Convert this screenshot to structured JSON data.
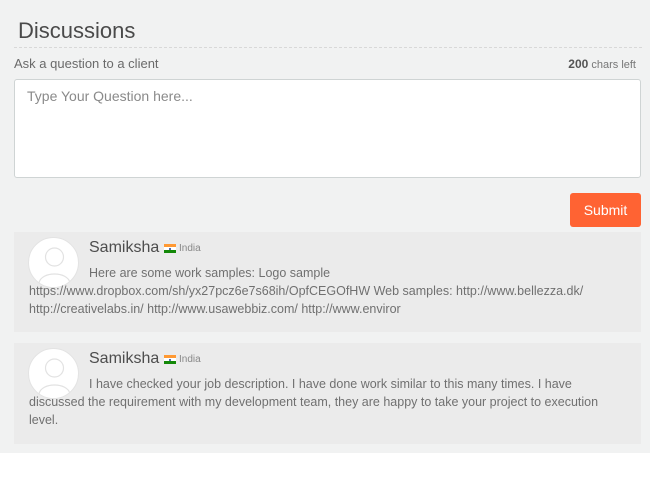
{
  "header": {
    "title": "Discussions"
  },
  "form": {
    "label": "Ask a question to a client",
    "chars_count": "200",
    "chars_suffix": "chars left",
    "placeholder": "Type Your Question here...",
    "submit_label": "Submit"
  },
  "discussions": [
    {
      "name": "Samiksha",
      "location": "India",
      "message": "Here are some work samples: Logo sample https://www.dropbox.com/sh/yx27pcz6e7s68ih/OpfCEGOfHW Web samples: http://www.bellezza.dk/ http://creativelabs.in/ http://www.usawebbiz.com/ http://www.enviror"
    },
    {
      "name": "Samiksha",
      "location": "India",
      "message": "I have checked your job description. I have done work similar to this many times. I have discussed the requirement with my development team, they are happy to take your project to execution level."
    }
  ],
  "colors": {
    "accent": "#ff6333",
    "panel": "#f1f2f2",
    "card": "#ebebeb"
  },
  "icons": {
    "avatar": "user-silhouette-icon",
    "flag": "india-flag-icon"
  }
}
